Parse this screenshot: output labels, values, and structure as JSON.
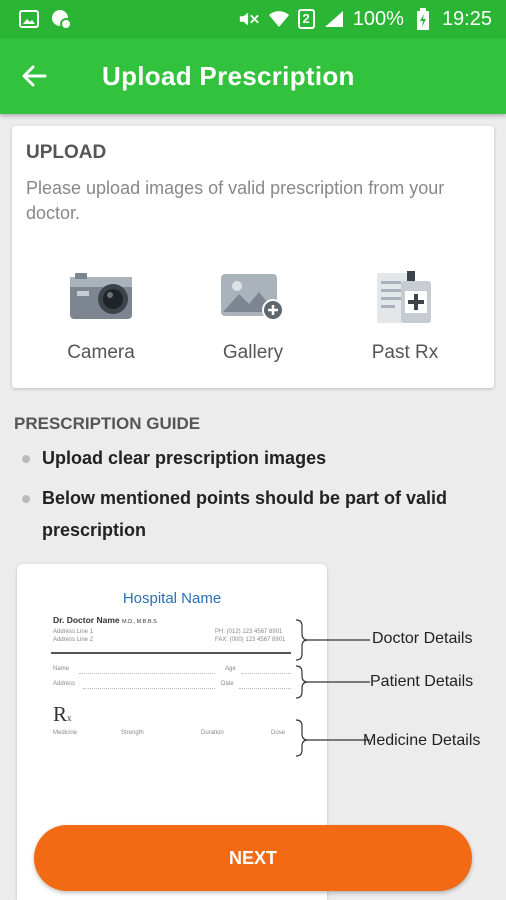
{
  "status_bar": {
    "battery": "100%",
    "time": "19:25",
    "sim_slot": "2",
    "icons": [
      "image-icon",
      "messenger-icon",
      "mute-icon",
      "wifi-icon",
      "sim-icon",
      "signal-icon",
      "battery-icon"
    ]
  },
  "app_bar": {
    "title": "Upload Prescription",
    "back_icon": "arrow-left-icon"
  },
  "upload_card": {
    "title": "UPLOAD",
    "description": "Please upload images of valid prescription from your doctor.",
    "options": [
      {
        "label": "Camera",
        "icon": "camera-icon"
      },
      {
        "label": "Gallery",
        "icon": "gallery-add-icon"
      },
      {
        "label": "Past Rx",
        "icon": "past-rx-icon"
      }
    ]
  },
  "guide": {
    "title": "PRESCRIPTION GUIDE",
    "bullets": [
      "Upload clear prescription images",
      "Below mentioned points should be part of valid prescription"
    ]
  },
  "sample": {
    "hospital": "Hospital Name",
    "doctor": "Dr. Doctor Name",
    "doctor_degree": "M.D., M.B.B.S",
    "address_line1": "Address Line 1",
    "address_line2": "Address Line 2",
    "phone": "PH: (012) 123 4567 8901",
    "fax": "FAX: (000) 123 4567 8901",
    "name_label": "Name",
    "age_label": "Age",
    "address_label": "Address",
    "date_label": "Date",
    "rx_symbol": "R",
    "rx_sub": "x",
    "columns": [
      "Medicine",
      "Strength",
      "Duration",
      "Dose"
    ],
    "callouts": [
      "Doctor Details",
      "Patient Details",
      "Medicine Details"
    ]
  },
  "next_button": "NEXT",
  "colors": {
    "status_bar": "#2bb534",
    "app_bar": "#33c23e",
    "accent": "#f26b14",
    "link": "#2a6fb6"
  }
}
